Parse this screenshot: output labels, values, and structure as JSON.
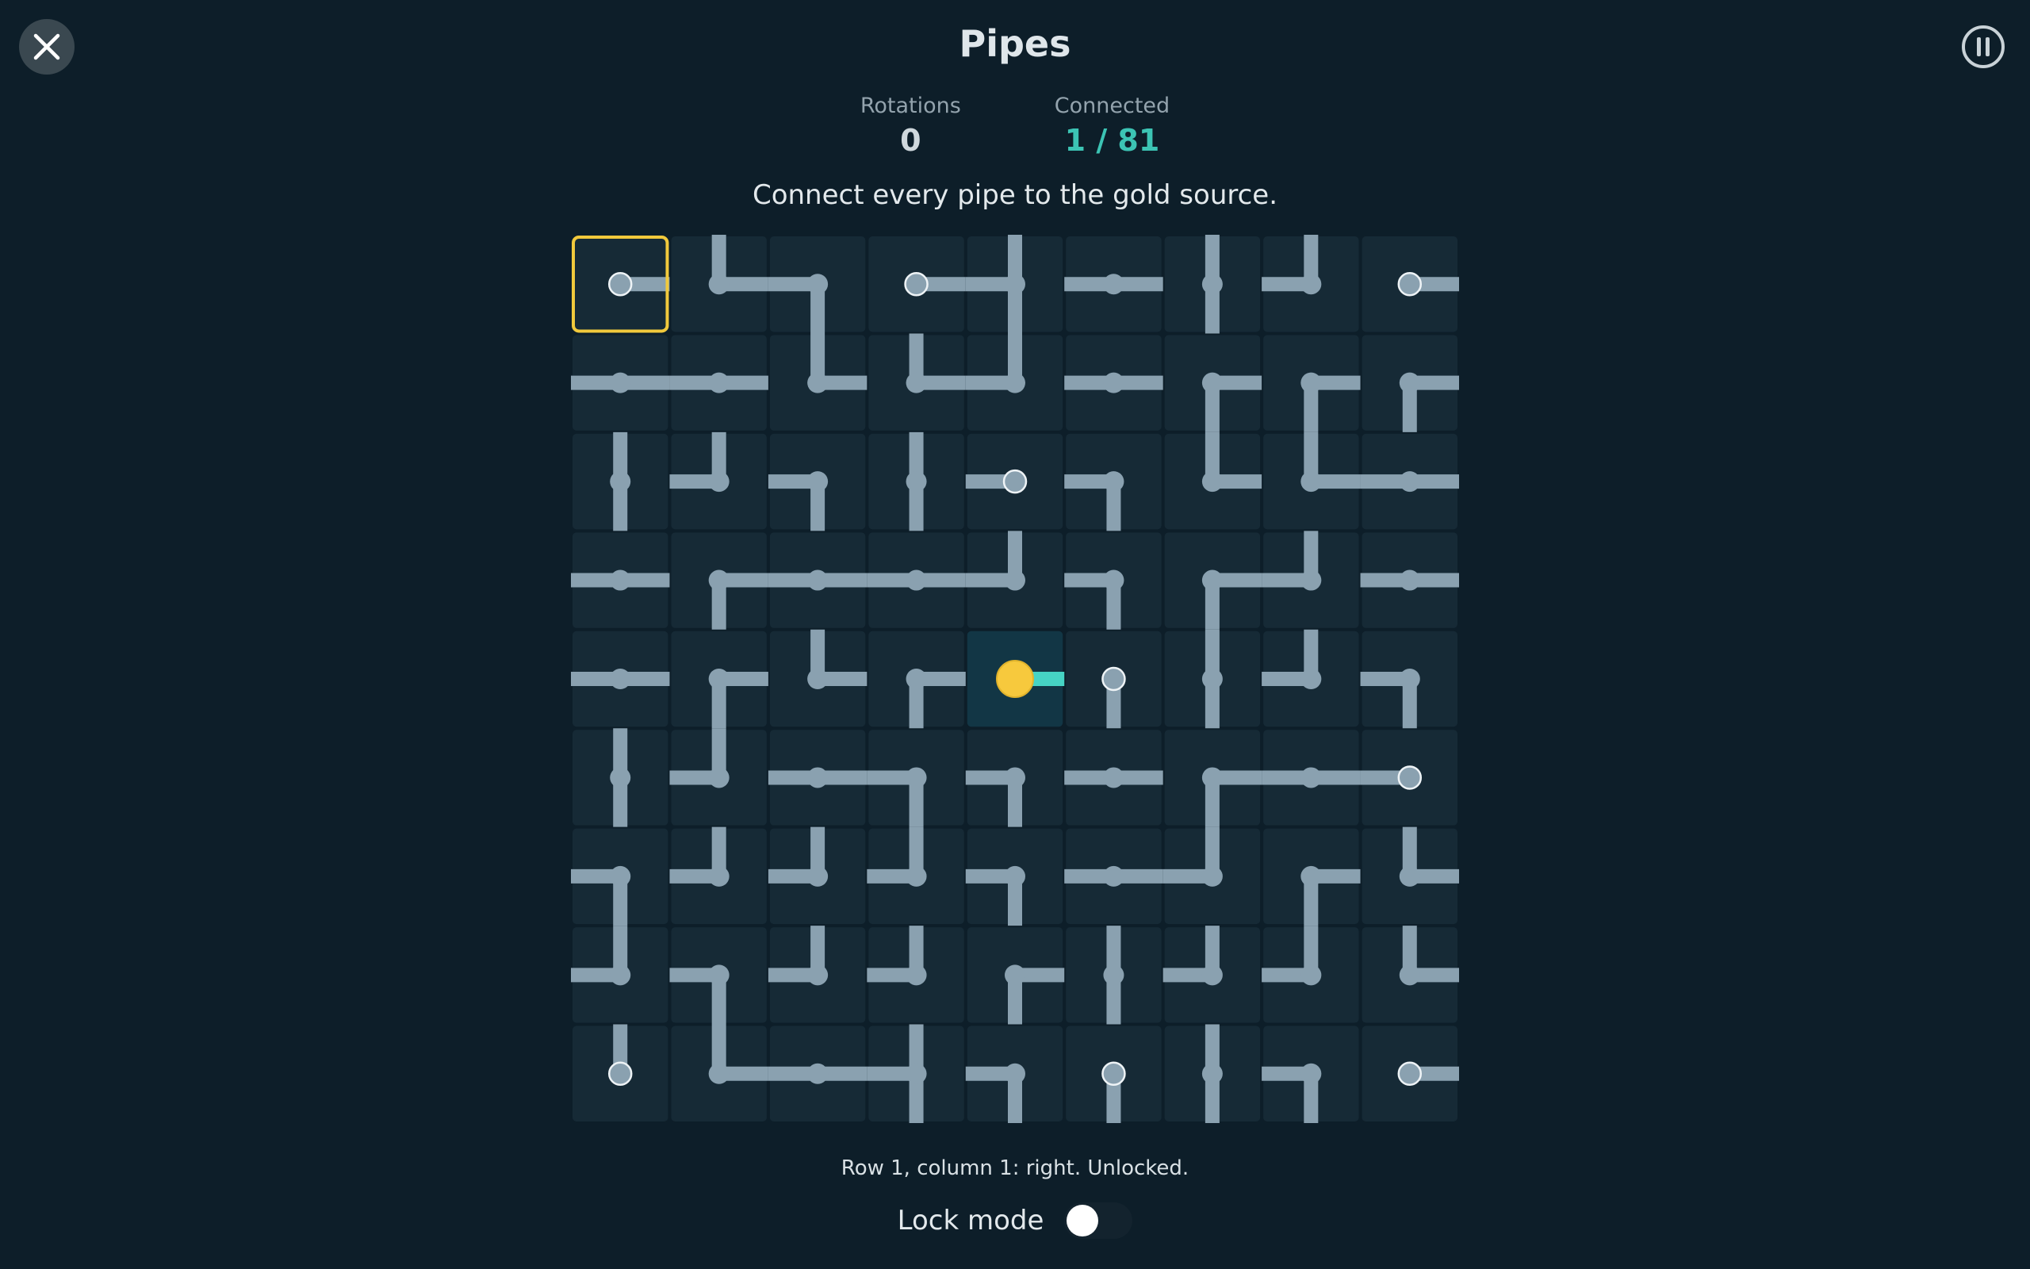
{
  "header": {
    "title": "Pipes",
    "close_icon": "close-icon",
    "pause_icon": "pause-icon"
  },
  "stats": {
    "rotations_label": "Rotations",
    "rotations_value": "0",
    "connected_label": "Connected",
    "connected_value": "1 / 81"
  },
  "instruction": "Connect every pipe to the gold source.",
  "board": {
    "rows": 9,
    "cols": 9,
    "selected": [
      0,
      0
    ],
    "source": [
      4,
      4
    ],
    "tiles": [
      [
        "E",
        "NE",
        "SW",
        "E",
        "NSW",
        "EW",
        "NS",
        "NW",
        "E"
      ],
      [
        "EW",
        "EW",
        "NE",
        "NE",
        "NW",
        "EW",
        "SE",
        "SE",
        "SE"
      ],
      [
        "NS",
        "NW",
        "SW",
        "NS",
        "W",
        "SW",
        "NE",
        "NE",
        "EW"
      ],
      [
        "EW",
        "SE",
        "EW",
        "EW",
        "NW",
        "SW",
        "SE",
        "NW",
        "EW"
      ],
      [
        "EW",
        "SE",
        "NE",
        "SE",
        "E",
        "S",
        "NS",
        "NW",
        "SW"
      ],
      [
        "NS",
        "NW",
        "EW",
        "SW",
        "SW",
        "EW",
        "SE",
        "EW",
        "W"
      ],
      [
        "SW",
        "NW",
        "NW",
        "NW",
        "SW",
        "EW",
        "NW",
        "SE",
        "NE"
      ],
      [
        "NW",
        "SW",
        "NW",
        "NW",
        "SE",
        "NS",
        "NW",
        "NW",
        "NE"
      ],
      [
        "N",
        "NE",
        "EW",
        "NSW",
        "SW",
        "S",
        "NS",
        "SW",
        "E"
      ]
    ],
    "colors": {
      "background": "#0d1e29",
      "tile": "#162a36",
      "pipe": "#8aa1b0",
      "connected_pipe": "#46d4c4",
      "source": "#f7c93d",
      "source_tile": "#123645",
      "selection": "#f1c93c"
    }
  },
  "status_text": "Row 1, column 1: right. Unlocked.",
  "lock_mode": {
    "label": "Lock mode",
    "enabled": false
  }
}
